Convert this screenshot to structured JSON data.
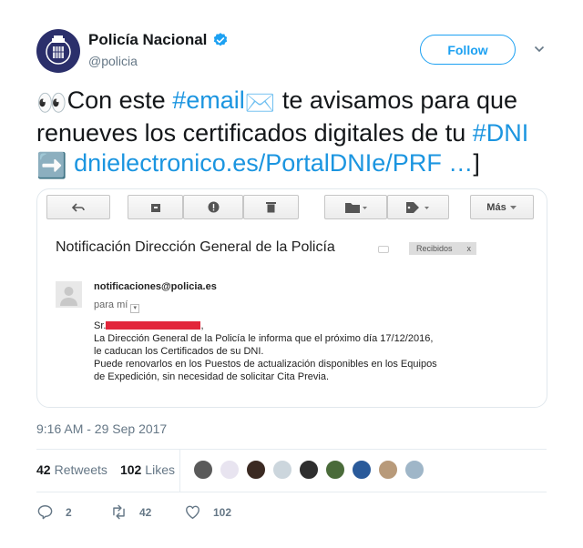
{
  "account": {
    "display_name": "Policía Nacional",
    "handle": "@policia",
    "avatar_icon": "police-badge-icon",
    "verified_icon": "verified-badge-icon",
    "follow_label": "Follow"
  },
  "tweet": {
    "emoji_eyes": "👀",
    "text_part1": "Con este ",
    "hashtag_email": "#email",
    "emoji_envelope": "✉️",
    "text_part2": " te avisamos para que renueves los certificados digitales de tu ",
    "hashtag_dni": "#DNI",
    "emoji_arrow": "➡️",
    "link": "dnielectronico.es/PortalDNIe/PRF …",
    "text_end": "]"
  },
  "media": {
    "toolbar": {
      "more_label": "Más"
    },
    "subject": "Notificación Dirección General de la Policía",
    "label": "Recibidos",
    "label_close": "x",
    "sender": "notificaciones@policia.es",
    "to": "para mí",
    "greeting": "Sr.",
    "body_lines": [
      "La Dirección General de la Policía le informa que el próximo día 17/12/2016,",
      "le caducan los Certificados de su DNI.",
      "Puede renovarlos en los Puestos de actualización disponibles en los Equipos",
      "de Expedición, sin necesidad de solicitar Cita Previa."
    ]
  },
  "timestamp": "9:16 AM - 29 Sep 2017",
  "stats": {
    "retweets_count": "42",
    "retweets_label": "Retweets",
    "likes_count": "102",
    "likes_label": "Likes"
  },
  "actions": {
    "reply_count": "2",
    "retweet_count": "42",
    "like_count": "102"
  },
  "colors": {
    "brand_blue": "#1da1f2",
    "link_blue": "#1b95e0",
    "muted": "#657786"
  }
}
